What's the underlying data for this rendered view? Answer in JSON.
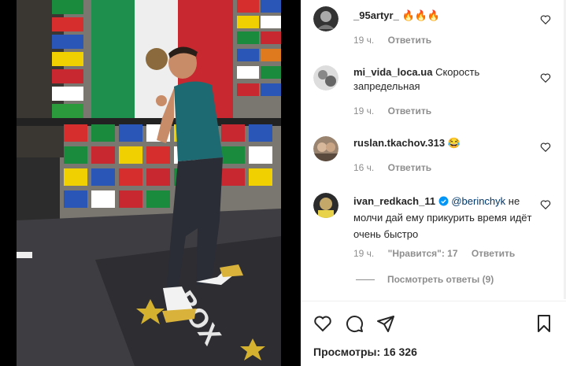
{
  "comments": [
    {
      "username": "_95artyr_",
      "text": "🔥🔥🔥",
      "time": "19 ч.",
      "reply": "Ответить"
    },
    {
      "username": "mi_vida_loca.ua",
      "text": "Скорость запредельная",
      "time": "19 ч.",
      "reply": "Ответить"
    },
    {
      "username": "ruslan.tkachov.313",
      "text": "😂",
      "time": "16 ч.",
      "reply": "Ответить"
    },
    {
      "username": "ivan_redkach_11",
      "mention": "@berinchyk",
      "text": "не молчи дай ему прикурить время идёт очень быстро",
      "time": "19 ч.",
      "likes": "\"Нравится\": 17",
      "reply": "Ответить",
      "verified": true
    }
  ],
  "view_replies": "Посмотреть ответы (9)",
  "views_label": "Просмотры: 16 326",
  "icons": {
    "like": "heart-icon",
    "comment": "comment-icon",
    "share": "share-icon",
    "save": "bookmark-icon",
    "verified": "verified-badge-icon"
  },
  "colors": {
    "mention": "#00376b",
    "meta": "#8e8e8e",
    "verified": "#0095f6"
  }
}
